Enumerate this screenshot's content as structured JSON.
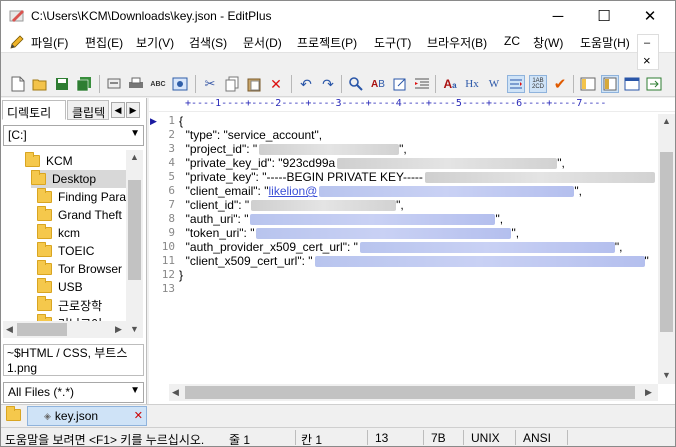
{
  "window": {
    "title": "C:\\Users\\KCM\\Downloads\\key.json - EditPlus",
    "min": "─",
    "max": "☐",
    "close": "✕"
  },
  "menu": [
    "파일(F)",
    "편집(E)",
    "보기(V)",
    "검색(S)",
    "문서(D)",
    "프로젝트(P)",
    "도구(T)",
    "브라우저(B)",
    "ZC",
    "창(W)",
    "도움말(H)"
  ],
  "mdi": {
    "min": "–",
    "close": "×"
  },
  "toolbar": {
    "icons": [
      "new-file-icon",
      "open-folder-icon",
      "save-icon",
      "save-all-icon",
      "print-preview-icon",
      "print-icon",
      "spell-check-icon",
      "browser-icon",
      "cut-icon",
      "copy-icon",
      "paste-icon",
      "delete-icon",
      "undo-icon",
      "redo-icon",
      "find-icon",
      "replace-icon",
      "goto-icon",
      "indent-icon",
      "font-icon",
      "hx-icon",
      "word-wrap-icon",
      "wrap-icon",
      "column-icon",
      "check-icon",
      "directory-window-icon",
      "output-window-icon",
      "cliptext-icon",
      "fullscreen-icon"
    ]
  },
  "sidebar": {
    "tabs": {
      "directory": "디렉토리",
      "cliptext": "클립텍"
    },
    "arrows": {
      "left": "◀",
      "right": "▶"
    },
    "drive": "[C:]",
    "tree": [
      {
        "label": "KCM",
        "level": 1
      },
      {
        "label": "Desktop",
        "level": 2,
        "selected": true
      },
      {
        "label": "Finding Para",
        "level": 3
      },
      {
        "label": "Grand Theft",
        "level": 3
      },
      {
        "label": "kcm",
        "level": 3
      },
      {
        "label": "TOEIC",
        "level": 3
      },
      {
        "label": "Tor Browser",
        "level": 3
      },
      {
        "label": "USB",
        "level": 3
      },
      {
        "label": "근로장학",
        "level": 3
      },
      {
        "label": "러닝코어",
        "level": 3
      }
    ],
    "files": [
      "~$HTML / CSS, 부트스",
      "1.png"
    ],
    "filter": "All Files (*.*)"
  },
  "editor": {
    "ruler": "+----1----+----2----+----3----+----4----+----5----+----6----+----7----",
    "line_numbers": [
      "1",
      "2",
      "3",
      "4",
      "5",
      "6",
      "7",
      "8",
      "9",
      "10",
      "11",
      "12",
      "13"
    ],
    "lines": [
      {
        "text": "{"
      },
      {
        "text": "  \"type\": \"service_account\","
      },
      {
        "text": "  \"project_id\": \"",
        "after": "\","
      },
      {
        "text": "  \"private_key_id\": \"923cd99a",
        "after": "\","
      },
      {
        "text": "  \"private_key\": \"-----BEGIN PRIVATE KEY-----"
      },
      {
        "text": "  \"client_email\": \"",
        "link": "likelion@",
        "after": "\","
      },
      {
        "text": "  \"client_id\": \"",
        "after": "\","
      },
      {
        "text": "  \"auth_uri\": \"",
        "after": "\","
      },
      {
        "text": "  \"token_uri\": \"",
        "after": "\","
      },
      {
        "text": "  \"auth_provider_x509_cert_url\": \"",
        "after": "\","
      },
      {
        "text": "  \"client_x509_cert_url\": \"",
        "after": "\""
      },
      {
        "text": "}"
      },
      {
        "text": ""
      }
    ]
  },
  "doc_tab": {
    "name": "key.json",
    "close": "✕"
  },
  "status": {
    "help": "도움말을 보려면 <F1> 키를 누르십시오.",
    "line": "줄 1",
    "col": "칸 1",
    "lines_total": "13",
    "size": "7B",
    "format": "UNIX",
    "encoding": "ANSI"
  },
  "colors": {
    "accent": "#2a2ab8",
    "selection": "#cfe3f7",
    "redacted_blue": "#c0cbf2"
  }
}
